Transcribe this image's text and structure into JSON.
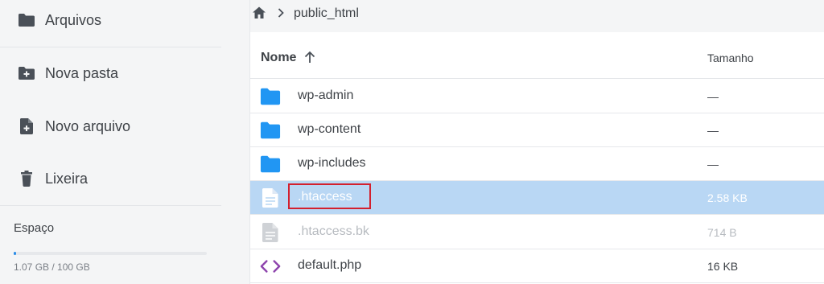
{
  "sidebar": {
    "items": [
      {
        "label": "Arquivos",
        "icon": "folder-icon"
      },
      {
        "label": "Nova pasta",
        "icon": "folder-plus-icon"
      },
      {
        "label": "Novo arquivo",
        "icon": "file-plus-icon"
      },
      {
        "label": "Lixeira",
        "icon": "trash-icon"
      }
    ],
    "space": {
      "title": "Espaço",
      "usage_text": "1.07 GB / 100 GB",
      "used_fraction": 0.0107
    }
  },
  "breadcrumb": {
    "home_icon": "home-icon",
    "current": "public_html"
  },
  "table": {
    "columns": {
      "name": "Nome",
      "size": "Tamanho"
    },
    "sort_icon": "arrow-up-icon",
    "rows": [
      {
        "name": "wp-admin",
        "size": "—",
        "type": "folder"
      },
      {
        "name": "wp-content",
        "size": "—",
        "type": "folder"
      },
      {
        "name": "wp-includes",
        "size": "—",
        "type": "folder"
      },
      {
        "name": ".htaccess",
        "size": "2.58 KB",
        "type": "file",
        "selected": true
      },
      {
        "name": ".htaccess.bk",
        "size": "714 B",
        "type": "file",
        "dimmed": true
      },
      {
        "name": "default.php",
        "size": "16 KB",
        "type": "code"
      }
    ]
  },
  "colors": {
    "accent": "#2b8de8",
    "folder": "#2196f3",
    "selected_row": "#b9d7f4",
    "code_icon": "#8e44ad",
    "highlight": "#d3202e"
  }
}
